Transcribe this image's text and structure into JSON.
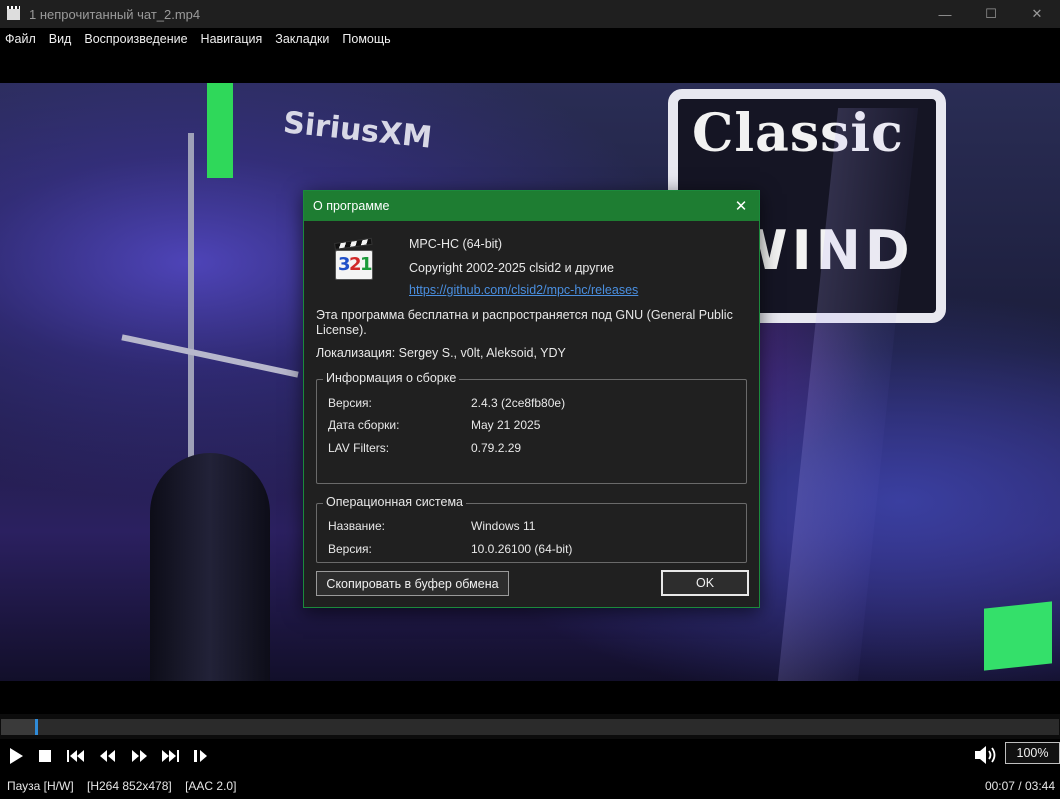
{
  "window": {
    "title": "1 непрочитанный чат_2.mp4",
    "minimize_glyph": "—",
    "maximize_glyph": "☐",
    "close_glyph": "✕"
  },
  "menu": [
    "Файл",
    "Вид",
    "Воспроизведение",
    "Навигация",
    "Закладки",
    "Помощь"
  ],
  "video_overlay_text": {
    "sirius": "SiriusXM",
    "sign_top": "Classic",
    "sign_bottom": "WIND"
  },
  "dialog": {
    "title": "О программе",
    "app_name": "MPC-HC (64-bit)",
    "copyright": "Copyright 2002-2025 clsid2 и другие",
    "link": "https://github.com/clsid2/mpc-hc/releases",
    "license": "Эта программа бесплатна и распространяется под GNU (General Public License).",
    "localization": "Локализация: Sergey S., v0lt, Aleksoid, YDY",
    "build_group": {
      "legend": "Информация о сборке",
      "rows": [
        {
          "label": "Версия:",
          "value": "2.4.3 (2ce8fb80e)"
        },
        {
          "label": "Дата сборки:",
          "value": "May 21 2025"
        },
        {
          "label": "LAV Filters:",
          "value": "0.79.2.29"
        }
      ]
    },
    "os_group": {
      "legend": "Операционная система",
      "rows": [
        {
          "label": "Название:",
          "value": "Windows 11"
        },
        {
          "label": "Версия:",
          "value": "10.0.26100 (64-bit)"
        }
      ]
    },
    "copy_button": "Скопировать в буфер обмена",
    "ok_button": "OK"
  },
  "playback": {
    "progress_fraction": 0.032,
    "volume": "100%",
    "status": "Пауза [H/W]    [H264 852x478]    [AAC 2.0]",
    "time": "00:07 / 03:44"
  },
  "colors": {
    "dialog_title_bg": "#1e7d32",
    "link": "#4a8fe0",
    "seek_thumb": "#2f8bd8"
  }
}
